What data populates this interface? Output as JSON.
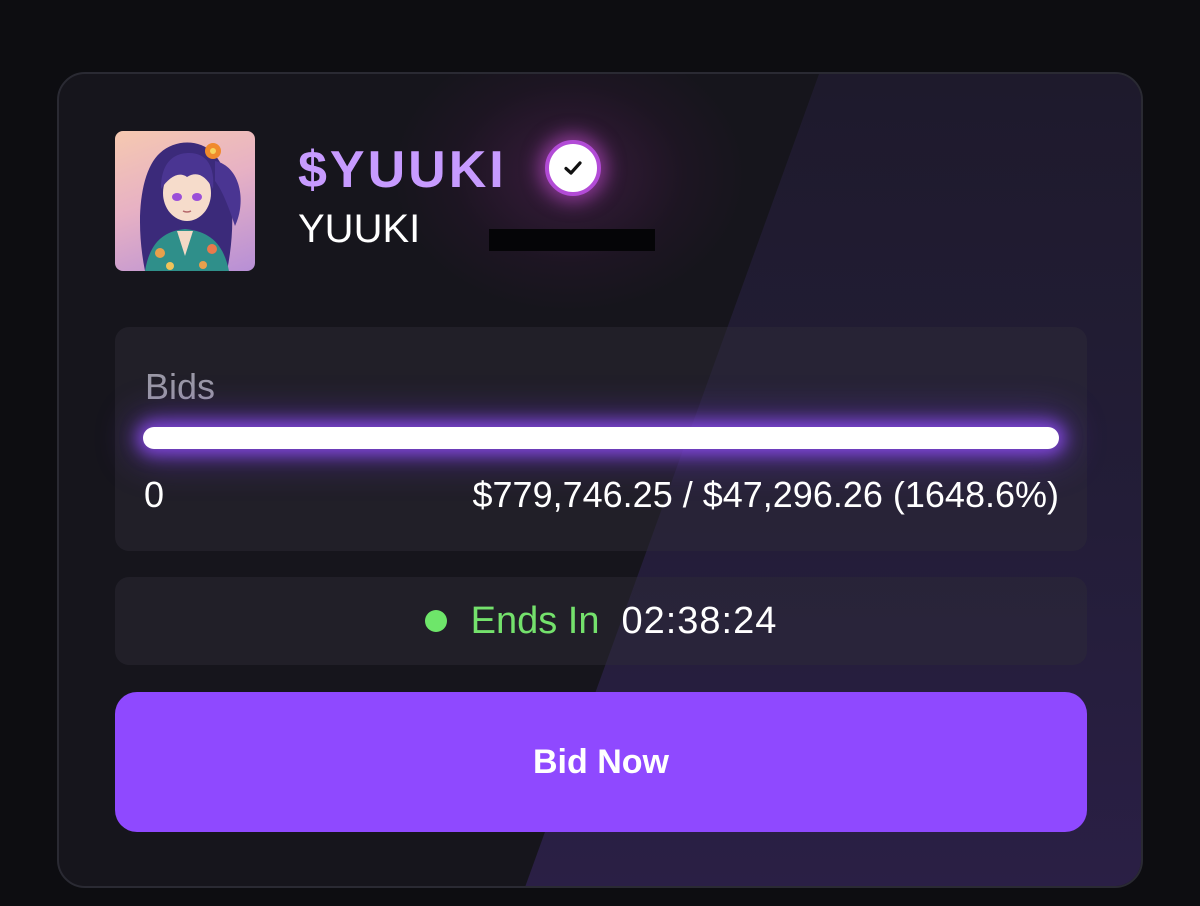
{
  "token": {
    "ticker": "$YUUKI",
    "name": "YUUKI",
    "verified_icon": "verified-check-icon",
    "avatar_icon": "anime-girl-avatar",
    "chain_icon": "base-chain-icon"
  },
  "bids": {
    "label": "Bids",
    "min_value": "0",
    "total_text": "$779,746.25 / $47,296.26 (1648.6%)",
    "progress_percent": 100
  },
  "timer": {
    "label": "Ends In",
    "value": "02:38:24",
    "status_color": "#6ee66a"
  },
  "action": {
    "bid_label": "Bid Now"
  },
  "colors": {
    "accent": "#8f49ff",
    "ticker": "#c79bff",
    "background": "#0d0d11"
  }
}
